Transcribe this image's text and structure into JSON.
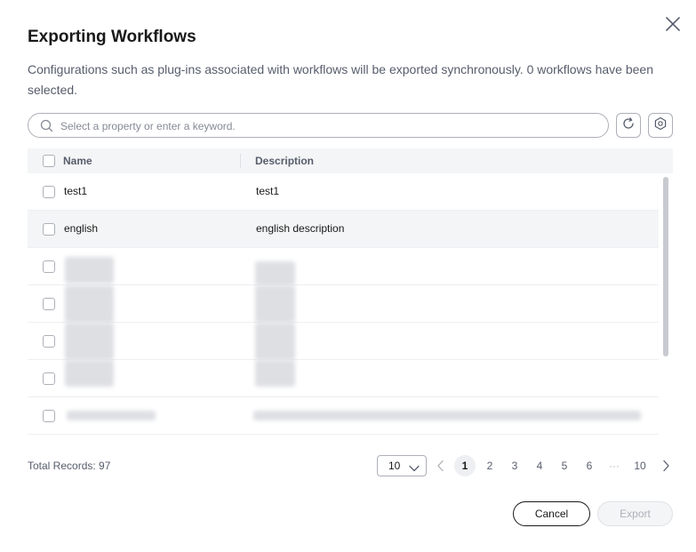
{
  "dialog": {
    "title": "Exporting Workflows",
    "description": "Configurations such as plug-ins associated with workflows will be exported synchronously. 0 workflows have been selected.",
    "close_icon": "close-icon"
  },
  "search": {
    "placeholder": "Select a property or enter a keyword.",
    "icon": "search-icon",
    "refresh_icon": "refresh-icon",
    "settings_icon": "gear-icon"
  },
  "table": {
    "columns": [
      "Name",
      "Description"
    ],
    "rows": [
      {
        "name": "test1",
        "description": "test1"
      },
      {
        "name": "english",
        "description": "english description"
      }
    ]
  },
  "pagination": {
    "total_label": "Total Records: 97",
    "page_size": "10",
    "pages": [
      "1",
      "2",
      "3",
      "4",
      "5",
      "6",
      "···",
      "10"
    ],
    "current_page": "1"
  },
  "footer": {
    "cancel_label": "Cancel",
    "export_label": "Export"
  },
  "colors": {
    "text": "#191919",
    "muted": "#575d6c",
    "border": "#adb0b8",
    "row_highlight": "#f4f5f6"
  }
}
